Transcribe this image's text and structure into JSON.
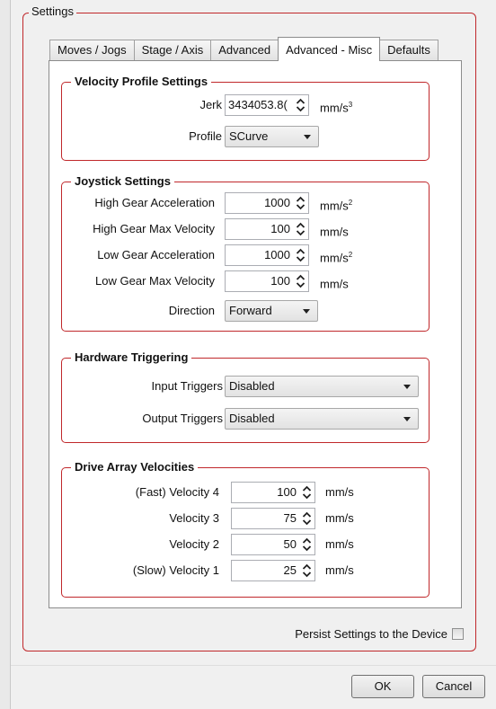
{
  "settings_group": {
    "title": "Settings"
  },
  "tabs": [
    {
      "label": "Moves / Jogs"
    },
    {
      "label": "Stage / Axis"
    },
    {
      "label": "Advanced"
    },
    {
      "label": "Advanced - Misc"
    },
    {
      "label": "Defaults"
    }
  ],
  "active_tab": "Advanced - Misc",
  "velocity_profile": {
    "title": "Velocity Profile Settings",
    "jerk": {
      "label": "Jerk",
      "value": "3434053.8(",
      "unit": "mm/s",
      "unit_exp": "3"
    },
    "profile": {
      "label": "Profile",
      "value": "SCurve"
    }
  },
  "joystick": {
    "title": "Joystick Settings",
    "rows": [
      {
        "label": "High Gear Acceleration",
        "value": "1000",
        "unit": "mm/s",
        "unit_exp": "2"
      },
      {
        "label": "High Gear Max Velocity",
        "value": "100",
        "unit": "mm/s",
        "unit_exp": ""
      },
      {
        "label": "Low Gear Acceleration",
        "value": "1000",
        "unit": "mm/s",
        "unit_exp": "2"
      },
      {
        "label": "Low Gear Max Velocity",
        "value": "100",
        "unit": "mm/s",
        "unit_exp": ""
      }
    ],
    "direction": {
      "label": "Direction",
      "value": "Forward"
    }
  },
  "hardware_triggering": {
    "title": "Hardware Triggering",
    "input": {
      "label": "Input Triggers",
      "value": "Disabled"
    },
    "output": {
      "label": "Output Triggers",
      "value": "Disabled"
    }
  },
  "drive_array": {
    "title": "Drive Array Velocities",
    "rows": [
      {
        "label": "(Fast) Velocity 4",
        "value": "100",
        "unit": "mm/s"
      },
      {
        "label": "Velocity 3",
        "value": "75",
        "unit": "mm/s"
      },
      {
        "label": "Velocity 2",
        "value": "50",
        "unit": "mm/s"
      },
      {
        "label": "(Slow) Velocity 1",
        "value": "25",
        "unit": "mm/s"
      }
    ]
  },
  "persist": {
    "label": "Persist Settings to the Device",
    "checked": false
  },
  "buttons": {
    "ok": "OK",
    "cancel": "Cancel"
  },
  "colors": {
    "group_border": "#c0282b",
    "panel_bg": "#ffffff",
    "window_bg": "#f0f0f0"
  }
}
